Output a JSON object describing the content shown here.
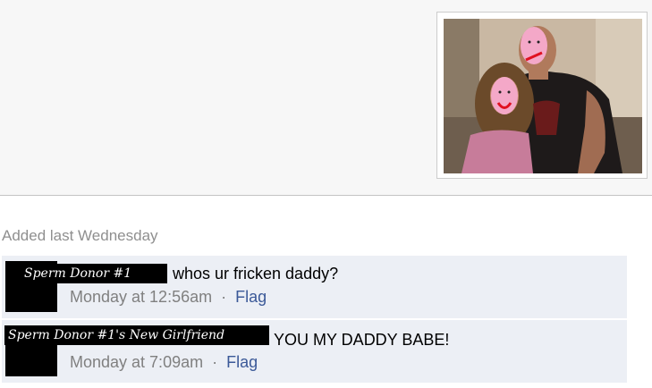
{
  "photo": {
    "alt": "photo"
  },
  "added_label": "Added last Wednesday",
  "comments": [
    {
      "author": "Sperm Donor #1",
      "text": "whos ur fricken daddy?",
      "time": "Monday at 12:56am",
      "separator": "·",
      "flag": "Flag"
    },
    {
      "author": "Sperm Donor #1's New Girlfriend",
      "text": "YOU MY DADDY BABE!",
      "time": "Monday at 7:09am",
      "separator": "·",
      "flag": "Flag"
    }
  ],
  "colors": {
    "link": "#3b5998",
    "comment_bg": "#eceff5",
    "meta_text": "#808080"
  }
}
